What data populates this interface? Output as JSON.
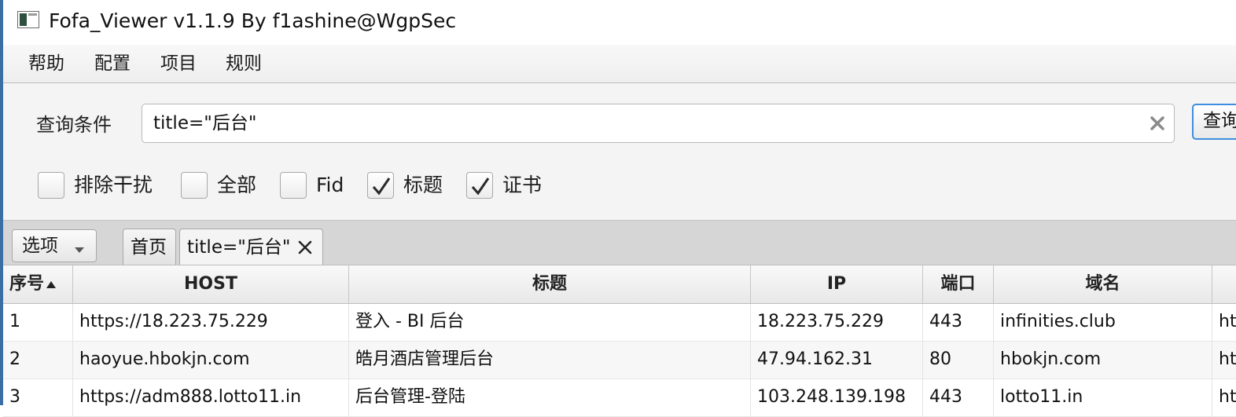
{
  "window": {
    "title": "Fofa_Viewer v1.1.9 By f1ashine@WgpSec"
  },
  "menu": [
    "帮助",
    "配置",
    "项目",
    "规则"
  ],
  "query": {
    "label": "查询条件",
    "value": "title=\"后台\"",
    "button_label": "查询"
  },
  "checkboxes": [
    {
      "label": "排除干扰",
      "checked": false
    },
    {
      "label": "全部",
      "checked": false
    },
    {
      "label": "Fid",
      "checked": false
    },
    {
      "label": "标题",
      "checked": true
    },
    {
      "label": "证书",
      "checked": true
    }
  ],
  "tabbar": {
    "options_label": "选项",
    "tabs": [
      {
        "label": "首页",
        "closable": false,
        "selected": false
      },
      {
        "label": "title=\"后台\"",
        "closable": true,
        "selected": true
      }
    ]
  },
  "table": {
    "columns": [
      "序号",
      "HOST",
      "标题",
      "IP",
      "端口",
      "域名",
      ""
    ],
    "rows": [
      [
        "1",
        "https://18.223.75.229",
        "登入 - BI 后台",
        "18.223.75.229",
        "443",
        "infinities.club",
        "ht"
      ],
      [
        "2",
        "haoyue.hbokjn.com",
        "皓月酒店管理后台",
        "47.94.162.31",
        "80",
        "hbokjn.com",
        "ht"
      ],
      [
        "3",
        "https://adm888.lotto11.in",
        "后台管理-登陆",
        "103.248.139.198",
        "443",
        "lotto11.in",
        "ht"
      ]
    ]
  },
  "colors": {
    "accent": "#3d8ee0",
    "window_edge": "#3b6ea5",
    "header_bg": "#e8e8e8"
  }
}
